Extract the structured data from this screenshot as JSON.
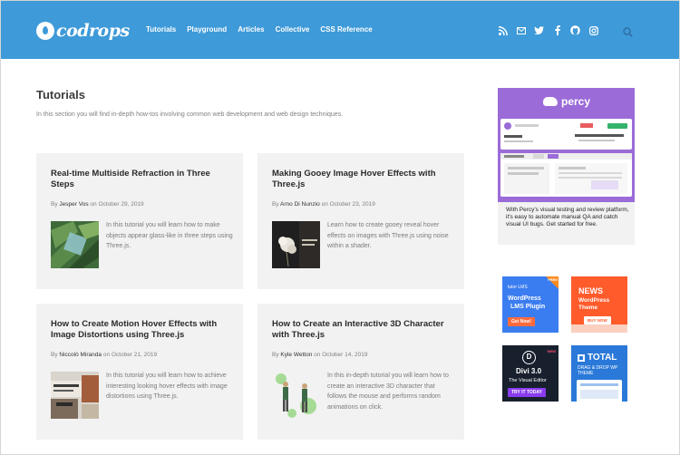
{
  "header": {
    "logo_text": "codrops",
    "nav": [
      "Tutorials",
      "Playground",
      "Articles",
      "Collective",
      "CSS Reference"
    ],
    "social_icons": [
      "rss-icon",
      "mail-icon",
      "twitter-icon",
      "facebook-icon",
      "github-icon",
      "instagram-icon"
    ],
    "colors": {
      "bar": "#3e9ad8",
      "text": "#ffffff"
    }
  },
  "page": {
    "title": "Tutorials",
    "description": "In this section you will find in-depth how-tos involving common web development and web design techniques."
  },
  "cards": [
    {
      "title": "Real-time Multiside Refraction in Three Steps",
      "by": "By",
      "author": "Jesper Vos",
      "on": "on",
      "date": "October 29, 2019",
      "excerpt": "In this tutorial you will learn how to make objects appear glass-like in three steps using Three.js."
    },
    {
      "title": "Making Gooey Image Hover Effects with Three.js",
      "by": "By",
      "author": "Arno Di Nunzio",
      "on": "on",
      "date": "October 23, 2019",
      "excerpt": "Learn how to create gooey reveal hover effects on images with Three.js using noise within a shader."
    },
    {
      "title": "How to Create Motion Hover Effects with Image Distortions using Three.js",
      "by": "By",
      "author": "Niccolò Miranda",
      "on": "on",
      "date": "October 21, 2019",
      "excerpt": "In this tutorial you will learn how to achieve interesting looking hover effects with image distortions using Three.js."
    },
    {
      "title": "How to Create an Interactive 3D Character with Three.js",
      "by": "By",
      "author": "Kyle Wetton",
      "on": "on",
      "date": "October 14, 2019",
      "excerpt": "In this in-depth tutorial you will learn how to create an interactive 3D character that follows the mouse and performs random animations on click."
    }
  ],
  "sidebar": {
    "percy": {
      "brand": "percy",
      "caption": "With Percy's visual testing and review platform, it's easy to automate manual QA and catch visual UI bugs. Get started for free."
    },
    "ads": [
      {
        "line1": "WordPress",
        "line2": "LMS Plugin",
        "small": "tutor LMS",
        "badge": "FREE",
        "button": "Get Now!",
        "bg": "#3a7df0"
      },
      {
        "line1": "NEWS",
        "line2": "WordPress Theme",
        "small": "",
        "badge": "",
        "button": "BUY NOW",
        "bg": "#ff5b2b"
      },
      {
        "line1": "Divi 3.0",
        "line2": "The Visual Editor",
        "small": "D",
        "badge": "NEW",
        "button": "TRY IT TODAY",
        "bg": "#18202e"
      },
      {
        "line1": "TOTAL",
        "line2": "DRAG & DROP WP THEME",
        "small": "",
        "badge": "",
        "button": "",
        "bg": "#2a79d8"
      }
    ]
  }
}
